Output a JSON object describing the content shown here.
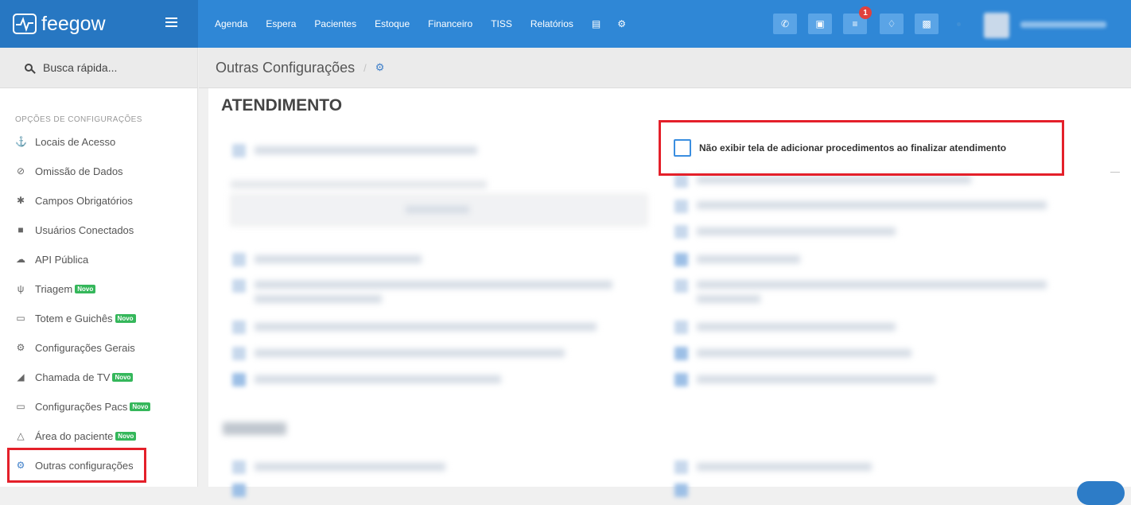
{
  "brand": {
    "name": "feegow"
  },
  "nav": {
    "items": [
      "Agenda",
      "Espera",
      "Pacientes",
      "Estoque",
      "Financeiro",
      "TISS",
      "Relatórios"
    ],
    "icons": [
      "database-icon",
      "gear-icon"
    ]
  },
  "toolbar": {
    "buttons": [
      "phone-icon",
      "inbox-icon",
      "tasks-icon",
      "bell-icon",
      "chat-icon"
    ],
    "notification_count": "1"
  },
  "sidebar": {
    "search_label": "Busca rápida...",
    "section_title": "OPÇÕES DE CONFIGURAÇÕES",
    "badge_label": "Novo",
    "items": [
      {
        "label": "Locais de Acesso",
        "icon": "map-pin-icon",
        "novo": false
      },
      {
        "label": "Omissão de Dados",
        "icon": "eye-slash-icon",
        "novo": false
      },
      {
        "label": "Campos Obrigatórios",
        "icon": "asterisk-icon",
        "novo": false
      },
      {
        "label": "Usuários Conectados",
        "icon": "user-icon",
        "novo": false
      },
      {
        "label": "API Pública",
        "icon": "cloud-icon",
        "novo": false
      },
      {
        "label": "Triagem",
        "icon": "stethoscope-icon",
        "novo": true
      },
      {
        "label": "Totem e Guichês",
        "icon": "laptop-icon",
        "novo": true
      },
      {
        "label": "Configurações Gerais",
        "icon": "gears-icon",
        "novo": false
      },
      {
        "label": "Chamada de TV",
        "icon": "megaphone-icon",
        "novo": true
      },
      {
        "label": "Configurações Pacs",
        "icon": "laptop-icon",
        "novo": true
      },
      {
        "label": "Área do paciente",
        "icon": "flask-icon",
        "novo": true
      },
      {
        "label": "Outras configurações",
        "icon": "gears-icon",
        "novo": false
      }
    ]
  },
  "breadcrumb": {
    "title": "Outras Configurações",
    "separator": "/"
  },
  "content": {
    "section_title": "ATENDIMENTO",
    "highlighted_option": {
      "label": "Não exibir tela de adicionar procedimentos ao finalizar atendimento",
      "checked": false
    }
  },
  "colors": {
    "topbar": "#2f87d6",
    "brand": "#2777c2",
    "highlight": "#e4202a",
    "novo_badge": "#35b75b"
  }
}
